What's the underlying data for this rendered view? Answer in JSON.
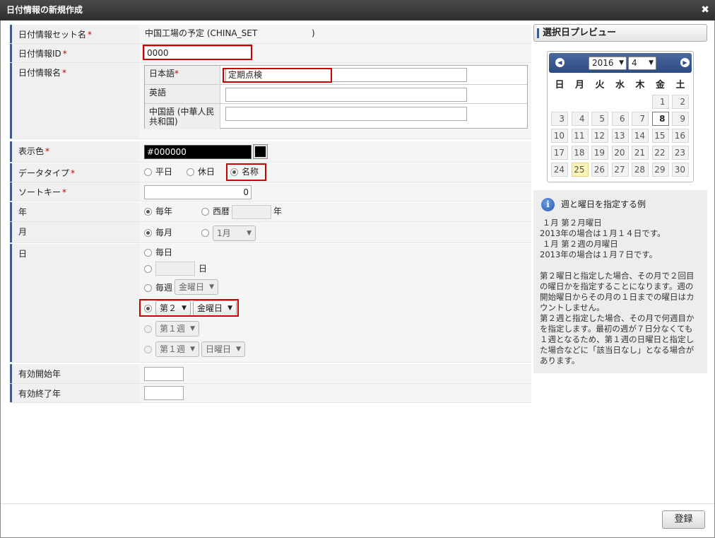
{
  "dialog": {
    "title": "日付情報の新規作成",
    "close_icon": "close-icon"
  },
  "form": {
    "set_name": {
      "label": "日付情報セット名",
      "value": "中国工場の予定 (CHINA_SET",
      "suffix": ")"
    },
    "id": {
      "label": "日付情報ID",
      "value": "0000"
    },
    "name": {
      "label": "日付情報名",
      "langs": [
        {
          "label": "日本語",
          "required": "*",
          "value": "定期点検"
        },
        {
          "label": "英語",
          "required": "",
          "value": ""
        },
        {
          "label": "中国語 (中華人民共和国)",
          "required": "",
          "value": ""
        }
      ]
    },
    "color": {
      "label": "表示色",
      "value": "#000000"
    },
    "data_type": {
      "label": "データタイプ",
      "options": [
        "平日",
        "休日",
        "名称"
      ],
      "selected": "名称"
    },
    "sort_key": {
      "label": "ソートキー",
      "value": "0"
    },
    "year": {
      "label": "年",
      "opt_every": "毎年",
      "opt_western": "西暦",
      "unit": "年",
      "selected": "毎年"
    },
    "month": {
      "label": "月",
      "opt_every": "毎月",
      "month_select": "1月",
      "selected": "毎月"
    },
    "day": {
      "label": "日",
      "opt_every": "毎日",
      "unit": "日",
      "opt_weekly": "毎週",
      "weekly_day": "金曜日",
      "nth_select": "第２",
      "nth_day": "金曜日",
      "week_select": "第１週",
      "week_select2": "第１週",
      "week_day2": "日曜日",
      "selected": "nth"
    },
    "valid_start": {
      "label": "有効開始年",
      "value": ""
    },
    "valid_end": {
      "label": "有効終了年",
      "value": ""
    },
    "required_mark": "*"
  },
  "preview": {
    "title": "選択日プレビュー",
    "year": "2016",
    "month": "4",
    "weekdays": [
      "日",
      "月",
      "火",
      "水",
      "木",
      "金",
      "土"
    ],
    "weeks": [
      [
        "",
        "",
        "",
        "",
        "",
        "1",
        "2"
      ],
      [
        "3",
        "4",
        "5",
        "6",
        "7",
        "8",
        "9"
      ],
      [
        "10",
        "11",
        "12",
        "13",
        "14",
        "15",
        "16"
      ],
      [
        "17",
        "18",
        "19",
        "20",
        "21",
        "22",
        "23"
      ],
      [
        "24",
        "25",
        "26",
        "27",
        "28",
        "29",
        "30"
      ]
    ],
    "today": "25",
    "selected_day": "8"
  },
  "info": {
    "title": "週と曜日を指定する例",
    "body": " １月 第２月曜日\n2013年の場合は１月１４日です。\n １月 第２週の月曜日\n2013年の場合は１月７日です。\n\n第２曜日と指定した場合、その月で２回目の曜日かを指定することになります。週の開始曜日からその月の１日までの曜日はカウントしません。\n第２週と指定した場合、その月で何週目かを指定します。最初の週が７日分なくても１週となるため、第１週の日曜日と指定した場合などに「該当日なし」となる場合があります。"
  },
  "footer": {
    "save_label": "登録"
  },
  "colors": {
    "accent": "#3c5a8c",
    "required": "#cc0000",
    "highlight_box": "#cc0000"
  }
}
